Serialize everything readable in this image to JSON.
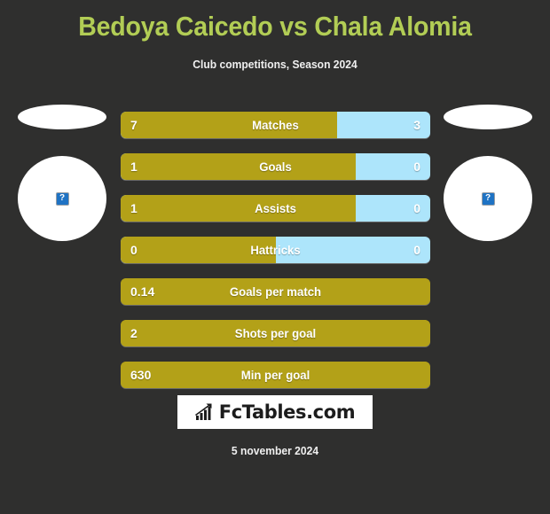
{
  "header": {
    "title": "Bedoya Caicedo vs Chala Alomia",
    "subtitle": "Club competitions, Season 2024",
    "title_color": "#b2cd55"
  },
  "players": {
    "left": {
      "avatar_alt": "?"
    },
    "right": {
      "avatar_alt": "?"
    }
  },
  "colors": {
    "background": "#2f2f2e",
    "home_bar": "#b3a118",
    "away_bar": "#ade5fb",
    "text": "#ffffff"
  },
  "stats": [
    {
      "label": "Matches",
      "home": "7",
      "away": "3",
      "home_pct": 70,
      "split": true
    },
    {
      "label": "Goals",
      "home": "1",
      "away": "0",
      "home_pct": 76,
      "split": true
    },
    {
      "label": "Assists",
      "home": "1",
      "away": "0",
      "home_pct": 76,
      "split": true
    },
    {
      "label": "Hattricks",
      "home": "0",
      "away": "0",
      "home_pct": 50,
      "split": true
    },
    {
      "label": "Goals per match",
      "home": "0.14",
      "away": "",
      "home_pct": 100,
      "split": false
    },
    {
      "label": "Shots per goal",
      "home": "2",
      "away": "",
      "home_pct": 100,
      "split": false
    },
    {
      "label": "Min per goal",
      "home": "630",
      "away": "",
      "home_pct": 100,
      "split": false
    }
  ],
  "footer": {
    "logo_text": "FcTables.com",
    "logo_icon": "bar-chart-icon",
    "date": "5 november 2024"
  }
}
